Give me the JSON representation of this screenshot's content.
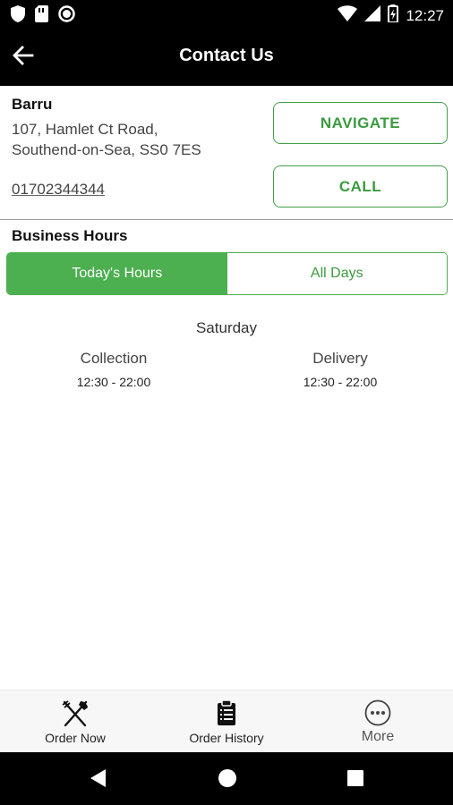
{
  "status_bar": {
    "time": "12:27",
    "icons": [
      "shield-icon",
      "sim-card-icon",
      "circle-status-icon",
      "wifi-icon",
      "signal-icon",
      "battery-icon"
    ]
  },
  "app_bar": {
    "title": "Contact Us",
    "back_icon": "arrow-left-icon"
  },
  "contact": {
    "name": "Barru",
    "address_line1": "107, Hamlet Ct Road,",
    "address_line2": "Southend-on-Sea, SS0 7ES",
    "phone": "01702344344",
    "navigate_label": "NAVIGATE",
    "call_label": "CALL"
  },
  "hours": {
    "title": "Business Hours",
    "tabs": [
      "Today's Hours",
      "All Days"
    ],
    "active_tab": "Today's Hours",
    "day": "Saturday",
    "collection": {
      "label": "Collection",
      "time": "12:30 - 22:00"
    },
    "delivery": {
      "label": "Delivery",
      "time": "12:30 - 22:00"
    }
  },
  "bottom_nav": {
    "items": [
      {
        "label": "Order Now",
        "icon": "fork-knife-icon"
      },
      {
        "label": "Order History",
        "icon": "clipboard-icon"
      },
      {
        "label": "More",
        "icon": "more-dots-icon"
      }
    ]
  },
  "system_nav": {
    "icons": [
      "back-triangle-icon",
      "home-circle-icon",
      "recents-square-icon"
    ]
  },
  "colors": {
    "accent": "#4caf50",
    "accent_text": "#3c9a40",
    "bar": "#000000"
  }
}
